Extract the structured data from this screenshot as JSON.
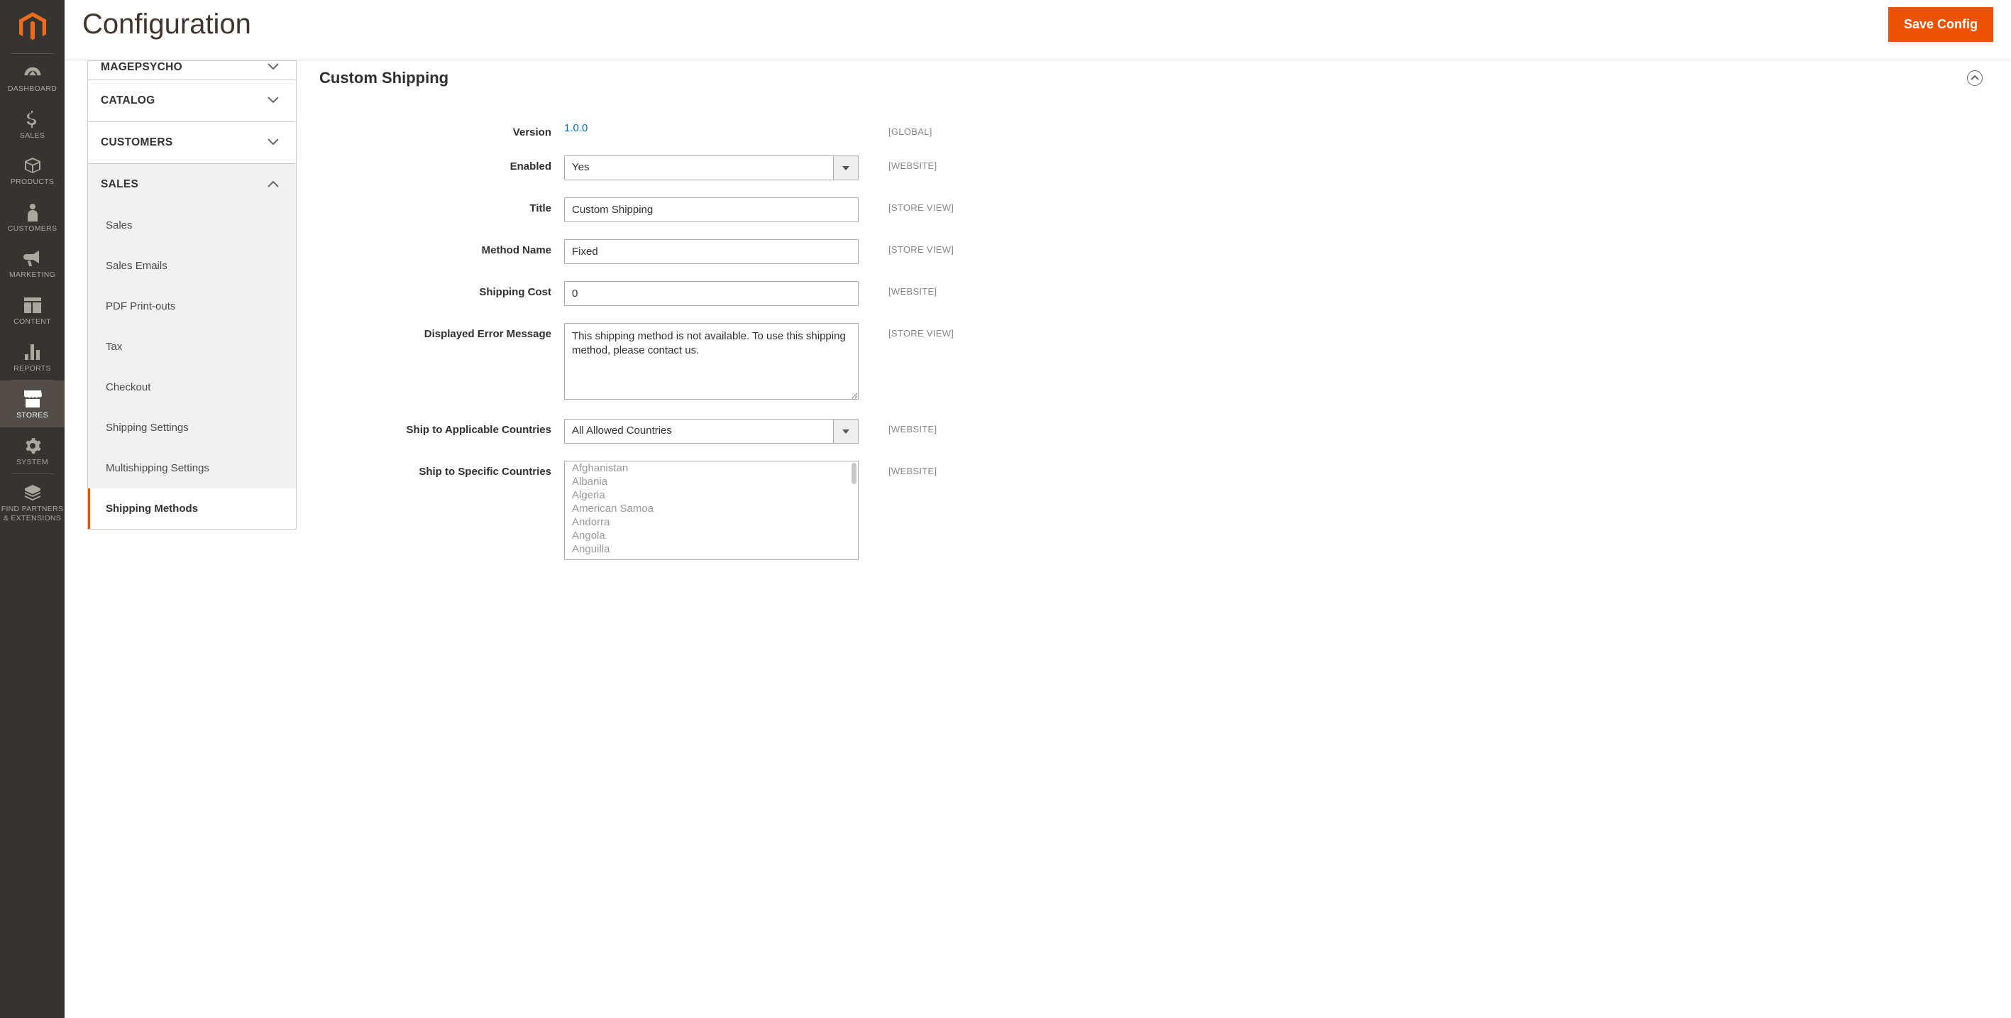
{
  "page": {
    "title": "Configuration",
    "save_button": "Save Config"
  },
  "nav": {
    "items": [
      {
        "id": "dashboard",
        "label": "DASHBOARD"
      },
      {
        "id": "sales",
        "label": "SALES"
      },
      {
        "id": "products",
        "label": "PRODUCTS"
      },
      {
        "id": "customers",
        "label": "CUSTOMERS"
      },
      {
        "id": "marketing",
        "label": "MARKETING"
      },
      {
        "id": "content",
        "label": "CONTENT"
      },
      {
        "id": "reports",
        "label": "REPORTS"
      },
      {
        "id": "stores",
        "label": "STORES"
      },
      {
        "id": "system",
        "label": "SYSTEM"
      },
      {
        "id": "partners",
        "label": "FIND PARTNERS\n& EXTENSIONS"
      }
    ],
    "active": "stores"
  },
  "tabs": {
    "groups": [
      {
        "id": "magepsycho",
        "label": "MAGEPSYCHO",
        "expanded": false,
        "cut": true
      },
      {
        "id": "catalog",
        "label": "CATALOG",
        "expanded": false
      },
      {
        "id": "customers",
        "label": "CUSTOMERS",
        "expanded": false
      },
      {
        "id": "sales",
        "label": "SALES",
        "expanded": true,
        "items": [
          {
            "id": "sales",
            "label": "Sales"
          },
          {
            "id": "sales_email",
            "label": "Sales Emails"
          },
          {
            "id": "pdf",
            "label": "PDF Print-outs"
          },
          {
            "id": "tax",
            "label": "Tax"
          },
          {
            "id": "checkout",
            "label": "Checkout"
          },
          {
            "id": "shipping",
            "label": "Shipping Settings"
          },
          {
            "id": "multishipping",
            "label": "Multishipping Settings"
          },
          {
            "id": "carriers",
            "label": "Shipping Methods",
            "active": true
          }
        ]
      }
    ]
  },
  "section": {
    "title": "Custom Shipping"
  },
  "scopes": {
    "global": "[GLOBAL]",
    "website": "[WEBSITE]",
    "store": "[STORE VIEW]"
  },
  "fields": {
    "version": {
      "label": "Version",
      "value": "1.0.0",
      "scope": "global"
    },
    "enabled": {
      "label": "Enabled",
      "value": "Yes",
      "scope": "website"
    },
    "title": {
      "label": "Title",
      "value": "Custom Shipping",
      "scope": "store"
    },
    "method_name": {
      "label": "Method Name",
      "value": "Fixed",
      "scope": "store"
    },
    "shipping_cost": {
      "label": "Shipping Cost",
      "value": "0",
      "scope": "website"
    },
    "error_msg": {
      "label": "Displayed Error Message",
      "value": "This shipping method is not available. To use this shipping method, please contact us.",
      "scope": "store"
    },
    "applicable": {
      "label": "Ship to Applicable Countries",
      "value": "All Allowed Countries",
      "scope": "website"
    },
    "specific": {
      "label": "Ship to Specific Countries",
      "scope": "website",
      "options": [
        "Afghanistan",
        "Albania",
        "Algeria",
        "American Samoa",
        "Andorra",
        "Angola",
        "Anguilla"
      ]
    }
  }
}
